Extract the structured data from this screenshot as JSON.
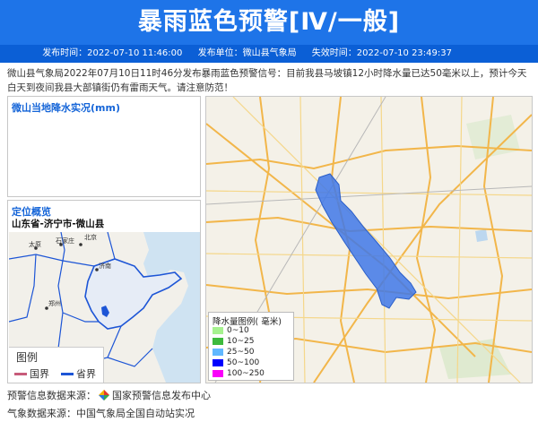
{
  "header": {
    "title": "暴雨蓝色预警[Ⅳ/一般]",
    "publish_time": "发布时间：2022-07-10 11:46:00",
    "publisher": "发布单位：微山县气象局",
    "expire_time": "失效时间：2022-07-10 23:49:37"
  },
  "description": "微山县气象局2022年07月10日11时46分发布暴雨蓝色预警信号：目前我县马坡镇12小时降水量已达50毫米以上，预计今天白天到夜间我县大部镇街仍有雷雨天气。请注意防范！",
  "rain_panel": {
    "title": "微山当地降水实况(mm)"
  },
  "location_panel": {
    "title": "定位概览",
    "path": "山东省-济宁市-微山县",
    "map_labels": [
      "北京",
      "石家庄",
      "太原",
      "济南",
      "郑州"
    ],
    "legend": {
      "title": "图例",
      "items": [
        {
          "label": "国界",
          "color": "#c75b7a"
        },
        {
          "label": "省界",
          "color": "#1d55d6"
        }
      ]
    }
  },
  "rain_legend": {
    "title": "降水量图例( 毫米)",
    "items": [
      {
        "label": "0~10",
        "color": "#a6f28f"
      },
      {
        "label": "10~25",
        "color": "#3dba3d"
      },
      {
        "label": "25~50",
        "color": "#61b8ff"
      },
      {
        "label": "50~100",
        "color": "#0000fe"
      },
      {
        "label": "100~250",
        "color": "#fa00fa"
      }
    ]
  },
  "footer": {
    "warning_source": "预警信息数据来源：",
    "warning_source_org": "国家预警信息发布中心",
    "weather_source": "气象数据来源：中国气象局全国自动站实况"
  },
  "colors": {
    "header_bg": "#1e74e8",
    "meta_bg": "#0b5fd6",
    "panel_title": "#1565d8",
    "warning_area": "#3f78e8"
  }
}
